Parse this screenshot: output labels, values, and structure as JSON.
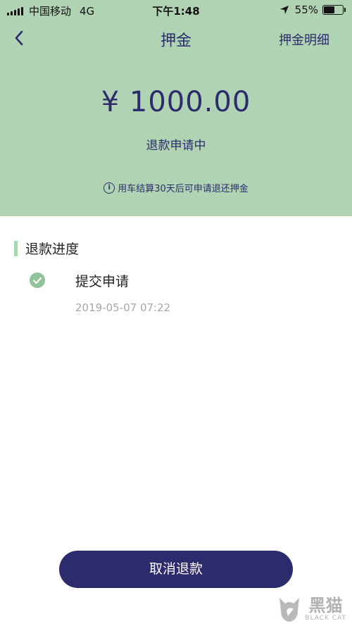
{
  "status_bar": {
    "carrier": "中国移动",
    "network": "4G",
    "time": "下午1:48",
    "battery_percent": "55%",
    "battery_level": 0.55
  },
  "nav": {
    "back_icon": "chevron-left-icon",
    "title": "押金",
    "detail_link": "押金明细"
  },
  "deposit": {
    "amount": "¥ 1000.00",
    "status": "退款申请中",
    "notice": "用车结算30天后可申请退还押金",
    "notice_icon": "info-icon",
    "notice_icon_glyph": "i"
  },
  "progress": {
    "title": "退款进度",
    "steps": [
      {
        "label": "提交申请",
        "time": "2019-05-07 07:22",
        "icon": "check-circle-icon",
        "done": true
      }
    ]
  },
  "actions": {
    "cancel_label": "取消退款"
  },
  "watermark": {
    "cn": "黑猫",
    "en": "BLACK CAT"
  },
  "colors": {
    "header_bg": "#b0d3b4",
    "accent_navy": "#2b2b6e",
    "success_green": "#8fc39b"
  }
}
